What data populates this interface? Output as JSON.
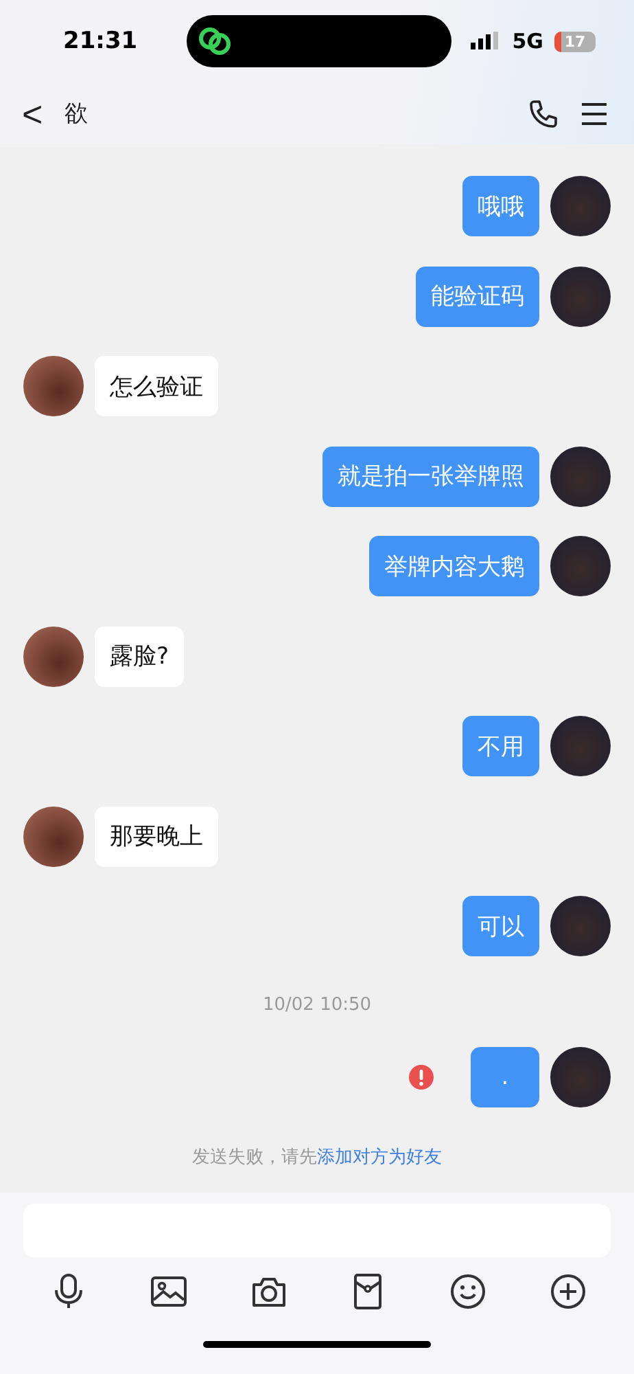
{
  "status_bar": {
    "time": "21:31",
    "network": "5G",
    "battery": "17"
  },
  "header": {
    "back": "<",
    "title": "欲"
  },
  "messages": [
    {
      "kind": "out",
      "text": "哦哦",
      "failed": false
    },
    {
      "kind": "out",
      "text": "能验证码",
      "failed": false
    },
    {
      "kind": "in",
      "text": "怎么验证",
      "failed": false
    },
    {
      "kind": "out",
      "text": "就是拍一张举牌照",
      "failed": false
    },
    {
      "kind": "out",
      "text": "举牌内容大鹅",
      "failed": false
    },
    {
      "kind": "in",
      "text": "露脸?",
      "failed": false
    },
    {
      "kind": "out",
      "text": "不用",
      "failed": false
    },
    {
      "kind": "in",
      "text": "那要晚上",
      "failed": false
    },
    {
      "kind": "out",
      "text": "可以",
      "failed": false
    },
    {
      "kind": "time",
      "text": "10/02 10:50"
    },
    {
      "kind": "out",
      "text": ".",
      "failed": true
    }
  ],
  "notice": {
    "text": "发送失败，请先",
    "link": "添加对方为好友"
  }
}
